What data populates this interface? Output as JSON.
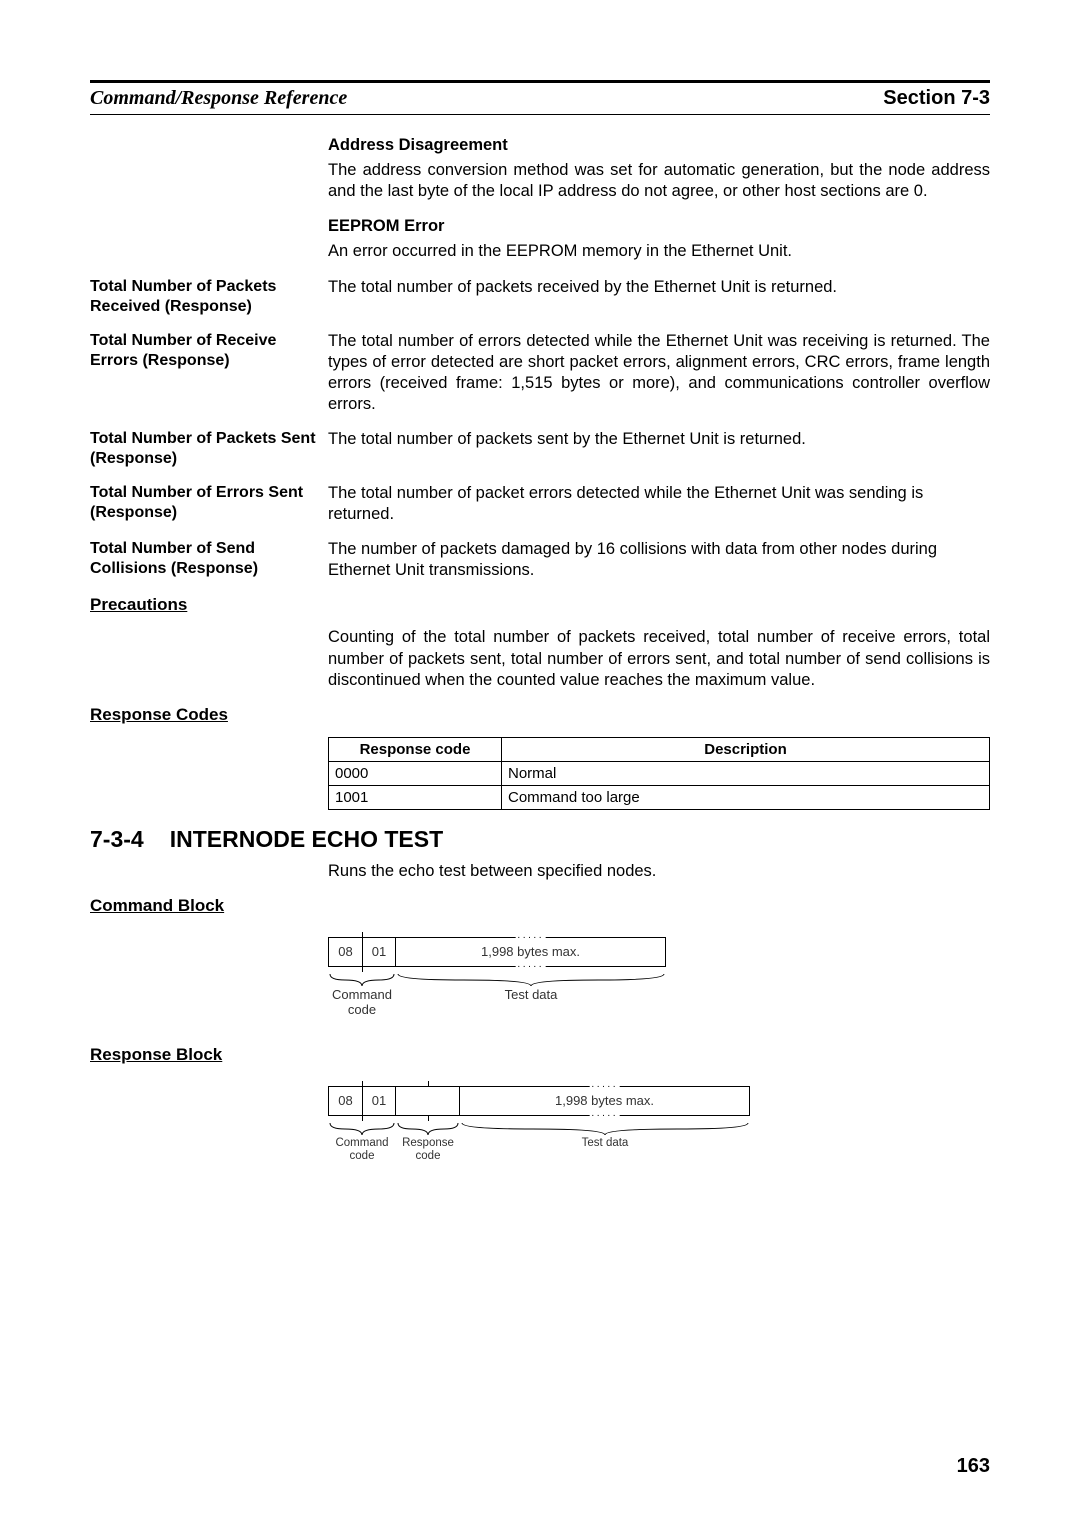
{
  "header": {
    "left": "Command/Response Reference",
    "right": "Section 7-3"
  },
  "address_disagreement": {
    "heading": "Address Disagreement",
    "body": "The address conversion method was set for automatic generation, but the node address and the last byte of the local IP address do not agree, or other host sections are 0."
  },
  "eeprom_error": {
    "heading": "EEPROM Error",
    "body": "An error occurred in the EEPROM memory in the Ethernet Unit."
  },
  "items": [
    {
      "side": "Total Number of Packets Received (Response)",
      "body": "The total number of packets received by the Ethernet Unit is returned."
    },
    {
      "side": "Total Number of Receive Errors (Response)",
      "body": "The total number of errors detected while the Ethernet Unit was receiving is returned. The types of error detected are short packet errors, alignment errors, CRC errors, frame length errors (received frame: 1,515 bytes or more), and communications controller overflow errors."
    },
    {
      "side": "Total Number of Packets Sent (Response)",
      "body": "The total number of packets sent by the Ethernet Unit is returned."
    },
    {
      "side": "Total Number of Errors Sent (Response)",
      "body": "The total number of packet errors detected while the Ethernet Unit was sending is returned."
    },
    {
      "side": "Total Number of Send Collisions (Response)",
      "body": "The number of packets damaged by 16 collisions with data from other nodes during Ethernet Unit transmissions."
    }
  ],
  "precautions": {
    "heading": "Precautions",
    "body": "Counting of the total number of packets received, total number of receive errors, total number of packets sent, total number of errors sent, and total number of send collisions is discontinued when the counted value reaches the maximum value."
  },
  "response_codes": {
    "heading": "Response Codes",
    "th1": "Response code",
    "th2": "Description",
    "rows": [
      {
        "code": "0000",
        "desc": "Normal"
      },
      {
        "code": "1001",
        "desc": "Command too large"
      }
    ]
  },
  "subsection": {
    "num": "7-3-4",
    "title": "INTERNODE ECHO TEST",
    "intro": "Runs the echo test between specified nodes."
  },
  "command_block": {
    "heading": "Command Block",
    "b0": "08",
    "b1": "01",
    "long": "1,998 bytes max.",
    "lbl_cmd": "Command code",
    "lbl_test": "Test data"
  },
  "response_block": {
    "heading": "Response Block",
    "b0": "08",
    "b1": "01",
    "long": "1,998 bytes max.",
    "lbl_cmd": "Command code",
    "lbl_resp": "Response code",
    "lbl_test": "Test data"
  },
  "page_number": "163"
}
